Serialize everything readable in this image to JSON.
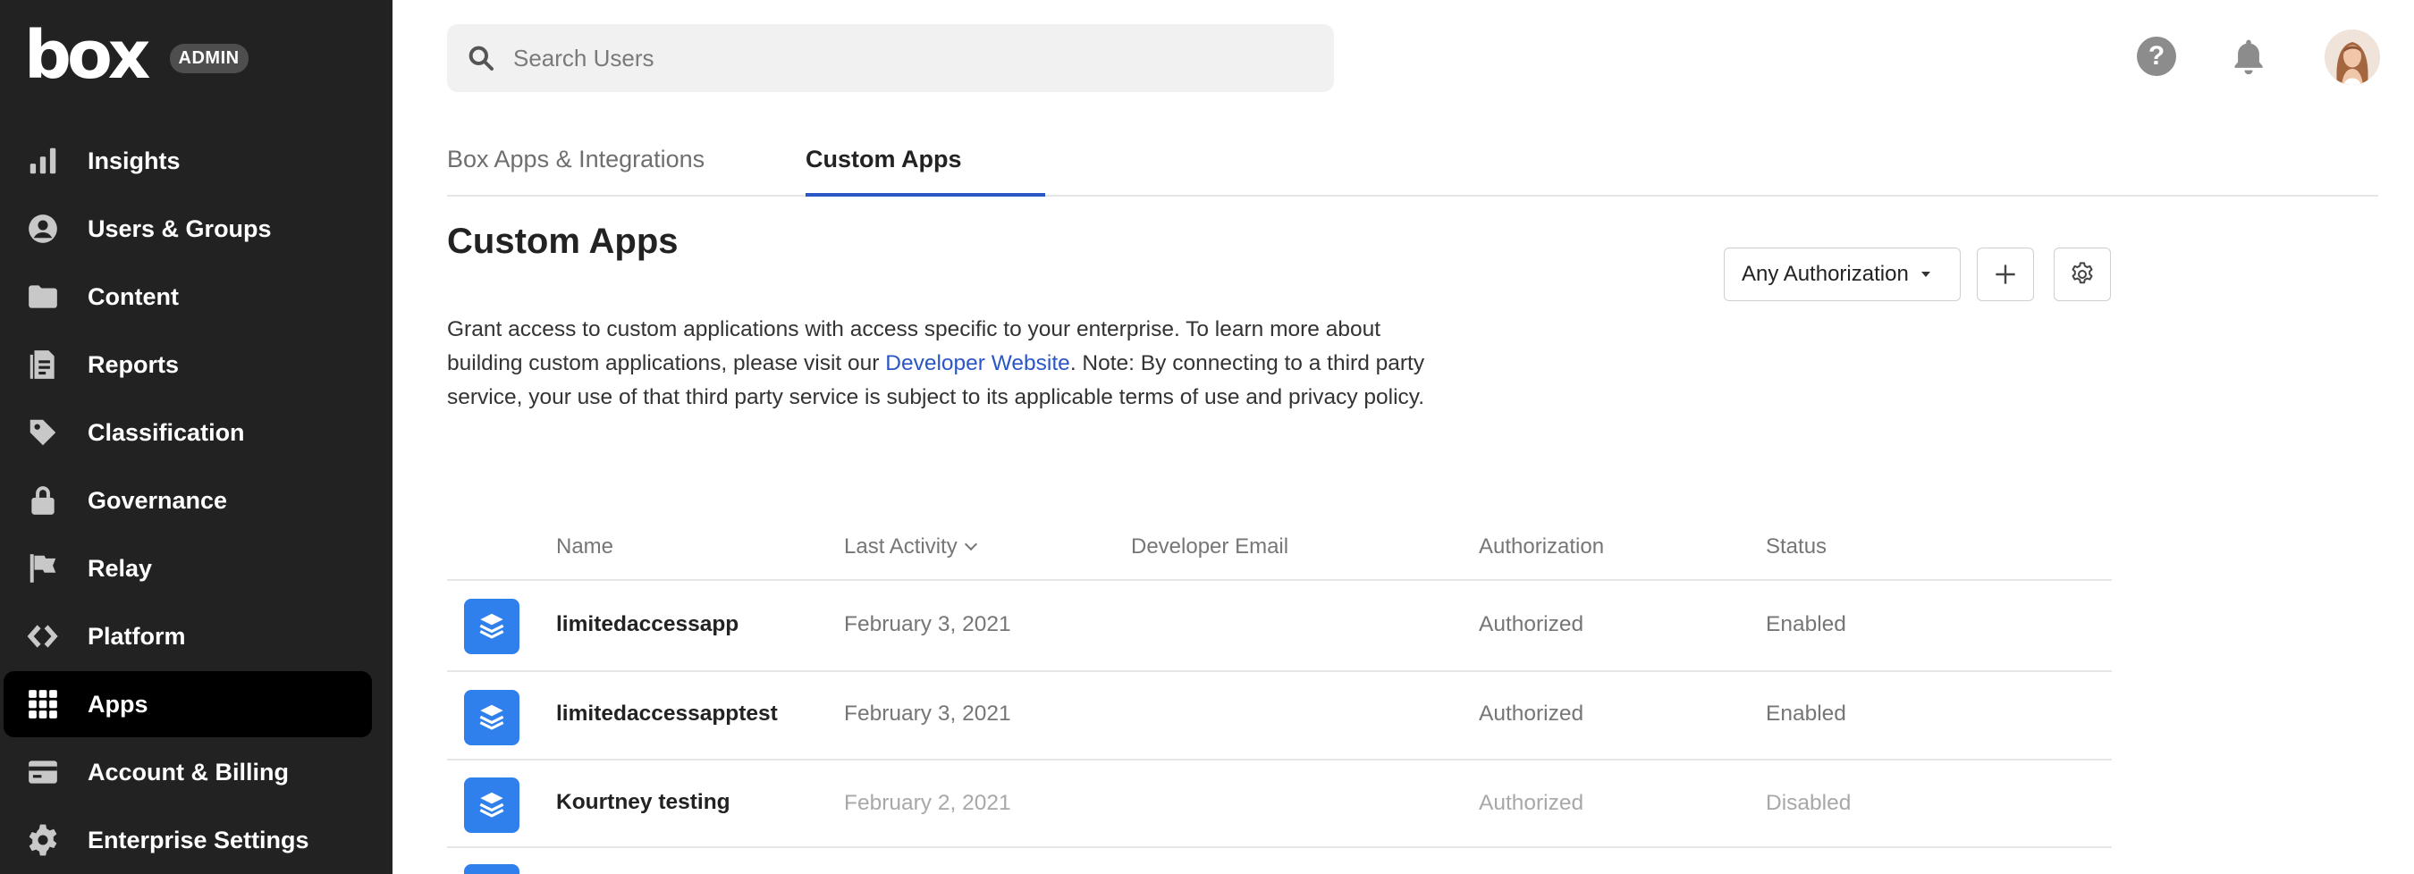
{
  "brand": {
    "logo_text": "box",
    "badge": "ADMIN"
  },
  "sidebar": {
    "items": [
      {
        "label": "Insights",
        "icon": "bar-chart-icon"
      },
      {
        "label": "Users & Groups",
        "icon": "user-circle-icon"
      },
      {
        "label": "Content",
        "icon": "folder-icon"
      },
      {
        "label": "Reports",
        "icon": "report-icon"
      },
      {
        "label": "Classification",
        "icon": "tag-icon"
      },
      {
        "label": "Governance",
        "icon": "lock-icon"
      },
      {
        "label": "Relay",
        "icon": "flag-icon"
      },
      {
        "label": "Platform",
        "icon": "code-icon"
      },
      {
        "label": "Apps",
        "icon": "grid-icon",
        "active": true
      },
      {
        "label": "Account & Billing",
        "icon": "credit-card-icon"
      },
      {
        "label": "Enterprise Settings",
        "icon": "gear-icon"
      }
    ]
  },
  "search": {
    "placeholder": "Search Users"
  },
  "header": {
    "help_icon": "help-icon",
    "notification_icon": "bell-icon",
    "avatar": "user-avatar"
  },
  "tabs": [
    {
      "label": "Box Apps & Integrations",
      "active": false
    },
    {
      "label": "Custom Apps",
      "active": true
    }
  ],
  "main": {
    "title": "Custom Apps",
    "description_before": "Grant access to custom applications with access specific to your enterprise. To learn more about building custom applications, please visit our ",
    "description_link": "Developer Website",
    "description_after": ". Note: By connecting to a third party service, your use of that third party service is subject to its applicable terms of use and privacy policy.",
    "filter_label": "Any Authorization",
    "add_icon": "plus-icon",
    "settings_icon": "gear-icon"
  },
  "table": {
    "columns": {
      "name": "Name",
      "last_activity": "Last Activity",
      "developer_email": "Developer Email",
      "authorization": "Authorization",
      "status": "Status"
    },
    "rows": [
      {
        "name": "limitedaccessapp",
        "last_activity": "February 3, 2021",
        "developer_email": "",
        "authorization": "Authorized",
        "status": "Enabled"
      },
      {
        "name": "limitedaccessapptest",
        "last_activity": "February 3, 2021",
        "developer_email": "",
        "authorization": "Authorized",
        "status": "Enabled"
      },
      {
        "name": "Kourtney testing",
        "last_activity": "February 2, 2021",
        "developer_email": "",
        "authorization": "Authorized",
        "status": "Disabled"
      }
    ]
  },
  "colors": {
    "sidebar_bg": "#222222",
    "accent": "#2b56c6",
    "app_icon": "#2f80ed"
  }
}
